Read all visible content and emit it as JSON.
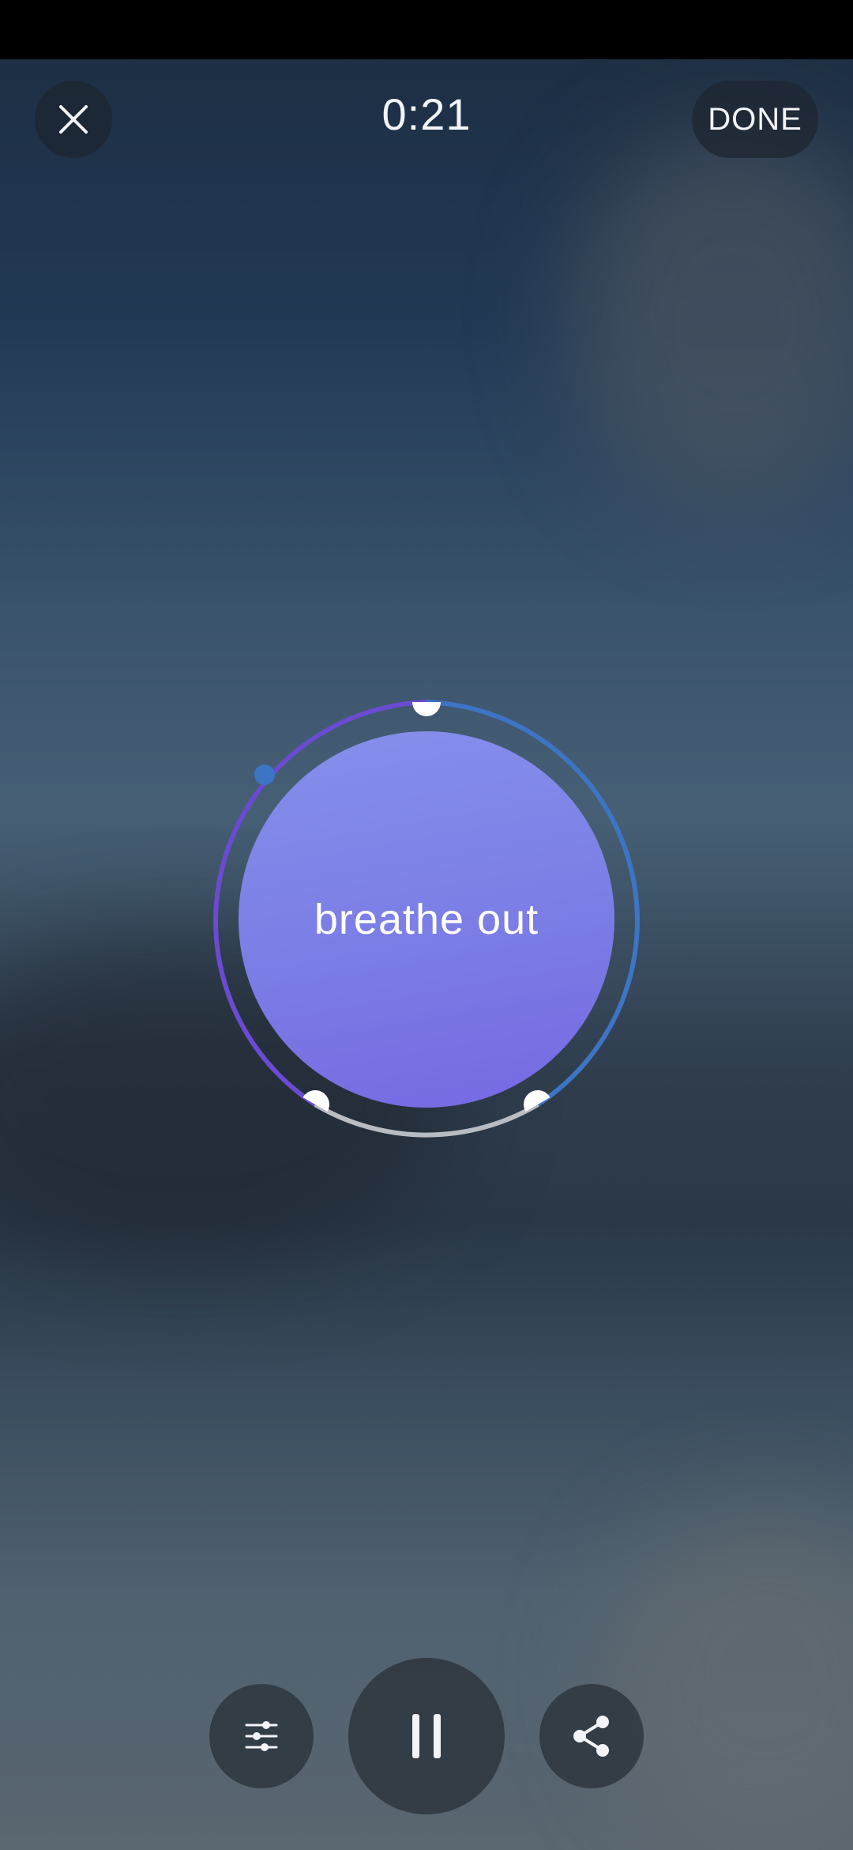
{
  "header": {
    "timer": "0:21",
    "done_label": "DONE"
  },
  "breath": {
    "phase_text": "breathe out",
    "colors": {
      "inhale_arc": "#6a4bd1",
      "exhale_arc": "#3d74c4",
      "hold_arc": "#b9bcc2",
      "circle_fill": "#7c7fe6"
    }
  },
  "controls": {
    "settings_icon": "sliders-icon",
    "pause_icon": "pause-icon",
    "share_icon": "share-icon"
  }
}
